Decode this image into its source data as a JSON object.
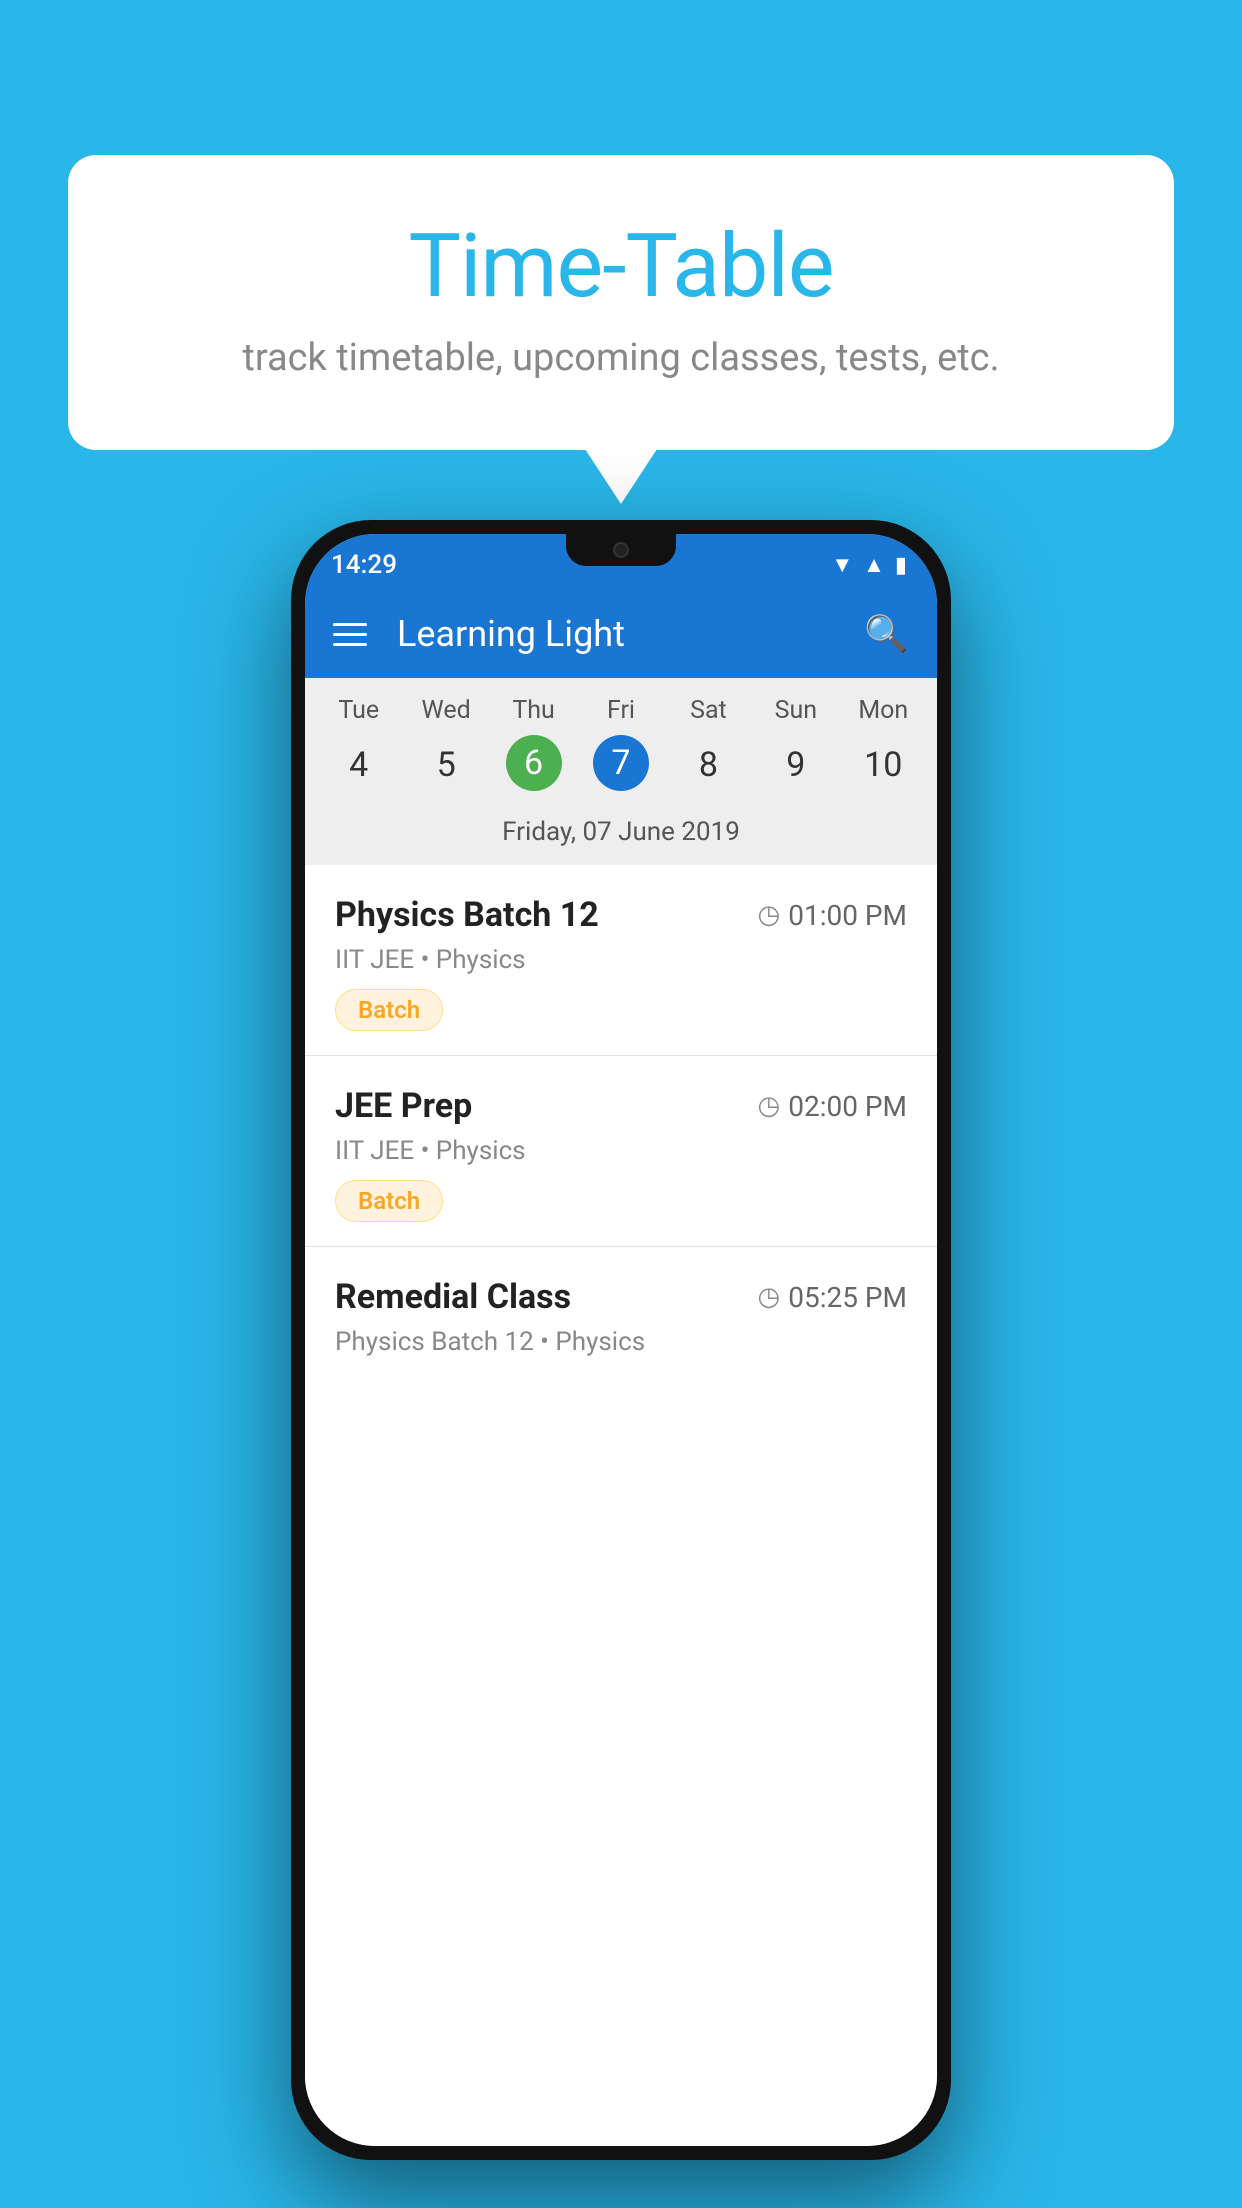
{
  "background_color": "#29b6e8",
  "bubble": {
    "title": "Time-Table",
    "subtitle": "track timetable, upcoming classes, tests, etc."
  },
  "phone": {
    "status_bar": {
      "time": "14:29"
    },
    "app_bar": {
      "title": "Learning Light"
    },
    "calendar": {
      "days": [
        "Tue",
        "Wed",
        "Thu",
        "Fri",
        "Sat",
        "Sun",
        "Mon"
      ],
      "dates": [
        "4",
        "5",
        "6",
        "7",
        "8",
        "9",
        "10"
      ],
      "today_index": 2,
      "selected_index": 3,
      "selected_date_label": "Friday, 07 June 2019"
    },
    "schedule": [
      {
        "title": "Physics Batch 12",
        "time": "01:00 PM",
        "subtitle": "IIT JEE • Physics",
        "badge": "Batch"
      },
      {
        "title": "JEE Prep",
        "time": "02:00 PM",
        "subtitle": "IIT JEE • Physics",
        "badge": "Batch"
      },
      {
        "title": "Remedial Class",
        "time": "05:25 PM",
        "subtitle": "Physics Batch 12 • Physics",
        "badge": ""
      }
    ]
  }
}
